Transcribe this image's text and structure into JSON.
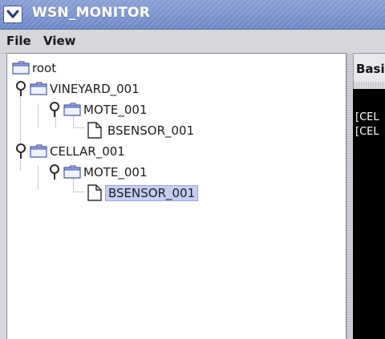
{
  "window": {
    "title": "WSN_MONITOR"
  },
  "menubar": {
    "items": [
      {
        "label": "File"
      },
      {
        "label": "View"
      }
    ]
  },
  "tree": {
    "nodes": [
      {
        "label": "root",
        "type": "folder",
        "depth": 0,
        "expanded": true,
        "selected": false
      },
      {
        "label": "VINEYARD_001",
        "type": "folder",
        "depth": 1,
        "expanded": true,
        "selected": false
      },
      {
        "label": "MOTE_001",
        "type": "folder",
        "depth": 2,
        "expanded": true,
        "selected": false
      },
      {
        "label": "BSENSOR_001",
        "type": "file",
        "depth": 3,
        "expanded": false,
        "selected": false
      },
      {
        "label": "CELLAR_001",
        "type": "folder",
        "depth": 1,
        "expanded": true,
        "selected": false
      },
      {
        "label": "MOTE_001",
        "type": "folder",
        "depth": 2,
        "expanded": true,
        "selected": false
      },
      {
        "label": "BSENSOR_001",
        "type": "file",
        "depth": 3,
        "expanded": false,
        "selected": true
      }
    ]
  },
  "right_panel": {
    "tab_label": "Basi",
    "console_lines": [
      "[CEL",
      "[CEL"
    ]
  },
  "colors": {
    "titlebar": "#7b92cc",
    "selection": "#c5cdf4",
    "console_bg": "#000000"
  },
  "icons": {
    "window_menu": "chevron-down-icon",
    "expanded_handle": "tree-expanded-handle-icon",
    "folder": "folder-icon",
    "file": "file-icon"
  }
}
